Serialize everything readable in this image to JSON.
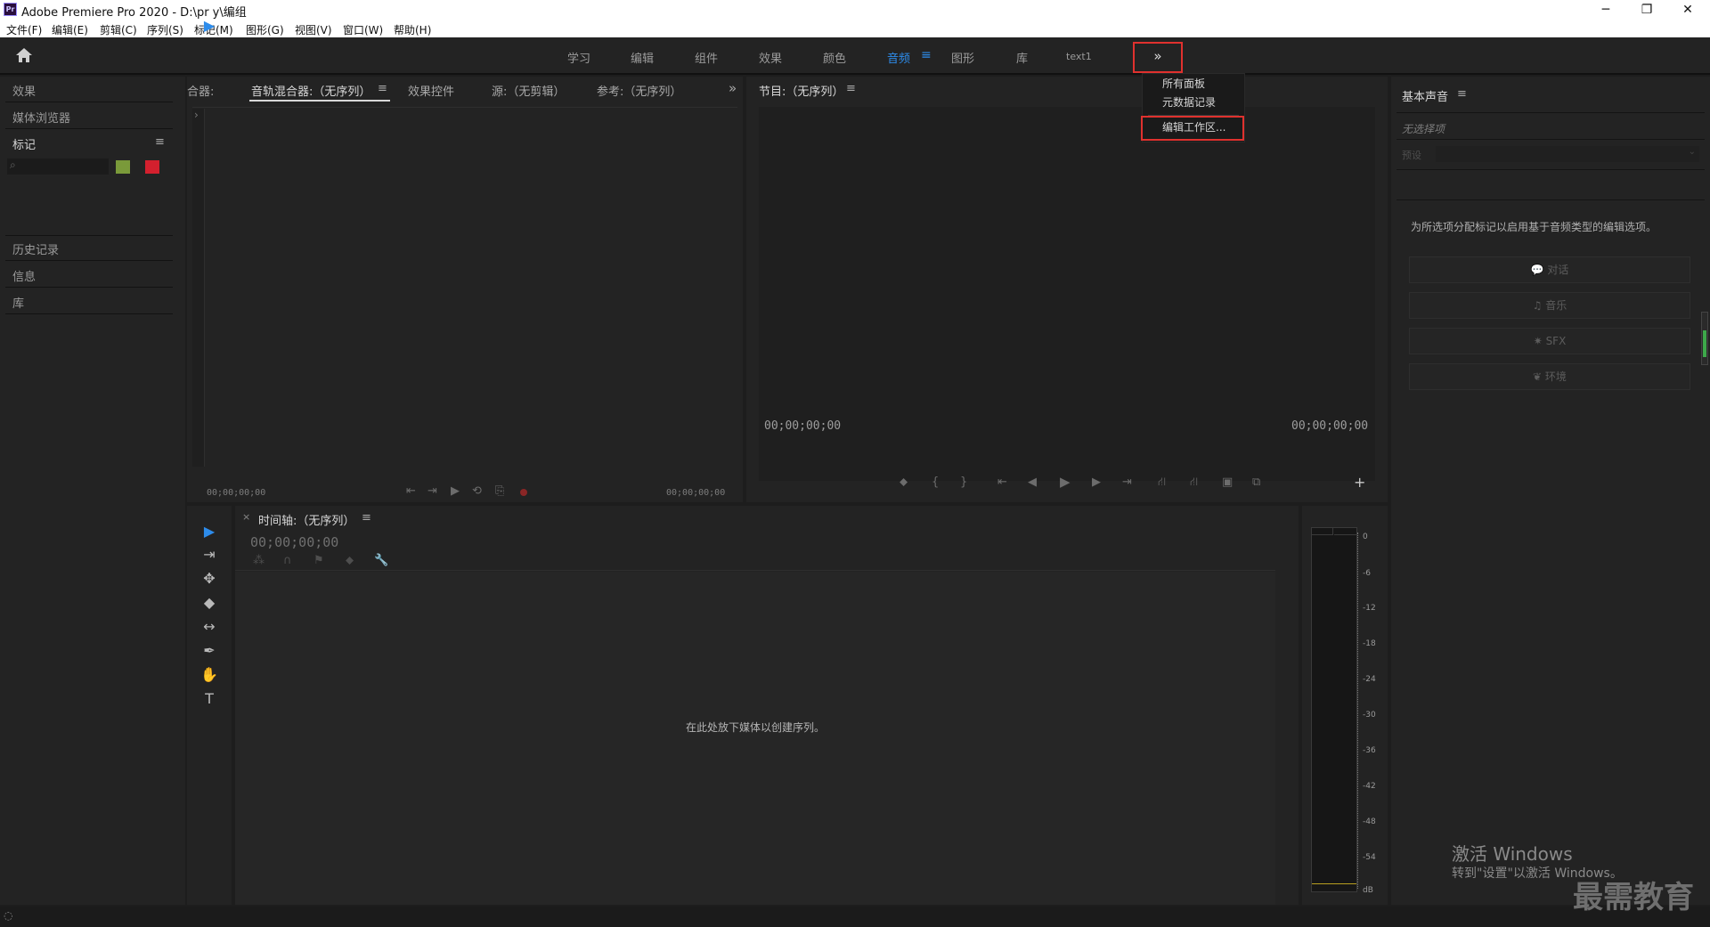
{
  "window": {
    "title": "Adobe Premiere Pro 2020 - D:\\pr y\\编组",
    "app_icon": "Pr",
    "minimize": "─",
    "restore": "❐",
    "close": "✕"
  },
  "menu": [
    "文件(F)",
    "编辑(E)",
    "剪辑(C)",
    "序列(S)",
    "标记(M)",
    "图形(G)",
    "视图(V)",
    "窗口(W)",
    "帮助(H)"
  ],
  "workspaces": {
    "tabs": [
      "学习",
      "编辑",
      "组件",
      "效果",
      "颜色",
      "音频",
      "图形",
      "库",
      "text1"
    ],
    "active": "音频",
    "more_glyph": "»",
    "dropdown": {
      "items": [
        "所有面板",
        "元数据记录"
      ],
      "edit_workspaces": "编辑工作区..."
    }
  },
  "left_panel": {
    "items_top": [
      "效果",
      "媒体浏览器"
    ],
    "markers": {
      "title": "标记",
      "menu_glyph": "≡",
      "search_glyph": "⌕"
    },
    "items_bottom": [
      "历史记录",
      "信息",
      "库"
    ]
  },
  "source_panel": {
    "truncated_tab": "合器:",
    "tabs": [
      "音轨混合器:（无序列）",
      "效果控件",
      "源:（无剪辑）",
      "参考:（无序列）"
    ],
    "active_tab": "音轨混合器:（无序列）",
    "menu_glyph": "≡",
    "overflow_glyph": "»",
    "timecode_left": "00;00;00;00",
    "timecode_right": "00;00;00;00",
    "expand_glyph": "›"
  },
  "program_panel": {
    "title": "节目:（无序列）",
    "menu_glyph": "≡",
    "timecode_left": "00;00;00;00",
    "timecode_right": "00;00;00;00",
    "add_glyph": "+"
  },
  "timeline": {
    "close_glyph": "×",
    "title": "时间轴:（无序列）",
    "menu_glyph": "≡",
    "timecode": "00;00;00;00",
    "drop_hint": "在此处放下媒体以创建序列。"
  },
  "tools": [
    "▶",
    "⇥",
    "✥",
    "◆",
    "↔",
    "✒",
    "✋",
    "T"
  ],
  "essential_sound": {
    "title": "基本声音",
    "menu_glyph": "≡",
    "no_selection": "无选择项",
    "preset_label": "预设",
    "hint": "为所选项分配标记以启用基于音频类型的编辑选项。",
    "buttons": [
      "对话",
      "音乐",
      "SFX",
      "环境"
    ]
  },
  "meter": {
    "labels": [
      "0",
      "-6",
      "-12",
      "-18",
      "-24",
      "-30",
      "-36",
      "-42",
      "-48",
      "-54",
      "dB"
    ]
  },
  "marker_colors": {
    "green": "#7a9a3a",
    "red": "#d3202e"
  },
  "accent": "#2d8ceb",
  "highlight": "#e0312e",
  "watermark": {
    "line1": "激活 Windows",
    "line2": "转到\"设置\"以激活 Windows。",
    "brand": "最需教育"
  }
}
